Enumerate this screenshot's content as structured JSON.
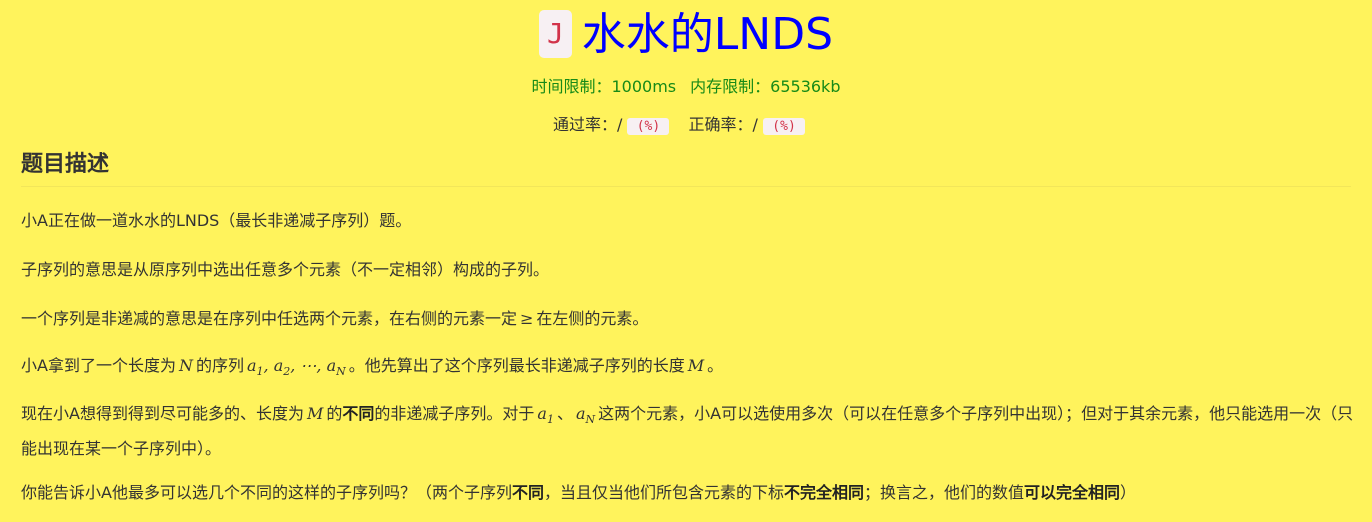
{
  "problem": {
    "badge": "J",
    "title": "水水的LNDS"
  },
  "limits": {
    "time": "时间限制：1000ms",
    "memory": "内存限制：65536kb"
  },
  "rates": {
    "pass_label": "通过率：/",
    "pass_value": "(%)",
    "correct_label": "正确率：/",
    "correct_value": "(%)"
  },
  "section": {
    "heading": "题目描述"
  },
  "paragraphs": {
    "p1": "小A正在做一道水水的LNDS（最长非递减子序列）题。",
    "p2": "子序列的意思是从原序列中选出任意多个元素（不一定相邻）构成的子列。",
    "p3a": "一个序列是非递减的意思是在序列中任选两个元素，在右侧的元素一定",
    "p3m": "≥",
    "p3b": "在左侧的元素。",
    "p4a": "小A拿到了一个长度为",
    "p4N": "N",
    "p4b": "的序列",
    "p4seq_a": "a",
    "p4s1": "1",
    "p4s2": "2",
    "p4dots": "⋯",
    "p4sN": "N",
    "p4c": "。他先算出了这个序列最长非递减子序列的长度",
    "p4M": "M",
    "p4d": "。",
    "p5a": "现在小A想得到得到尽可能多的、长度为",
    "p5M": "M",
    "p5b": "的",
    "p5bold": "不同",
    "p5c": "的非递减子序列。对于",
    "p5a1": "a",
    "p5s1": "1",
    "p5sep": "、",
    "p5aN": "a",
    "p5sN": "N",
    "p5d": "这两个元素，小A可以选使用多次（可以在任意多个子序列中出现）；但对于其余元素，他只能选用一次（只能出现在某一个子序列中）。",
    "p6a": "你能告诉小A他最多可以选几个不同的这样的子序列吗？（两个子序列",
    "p6b1": "不同",
    "p6b": "，当且仅当他们所包含元素的下标",
    "p6b2": "不完全相同",
    "p6c": "；换言之，他们的数值",
    "p6b3": "可以完全相同",
    "p6d": "）"
  }
}
